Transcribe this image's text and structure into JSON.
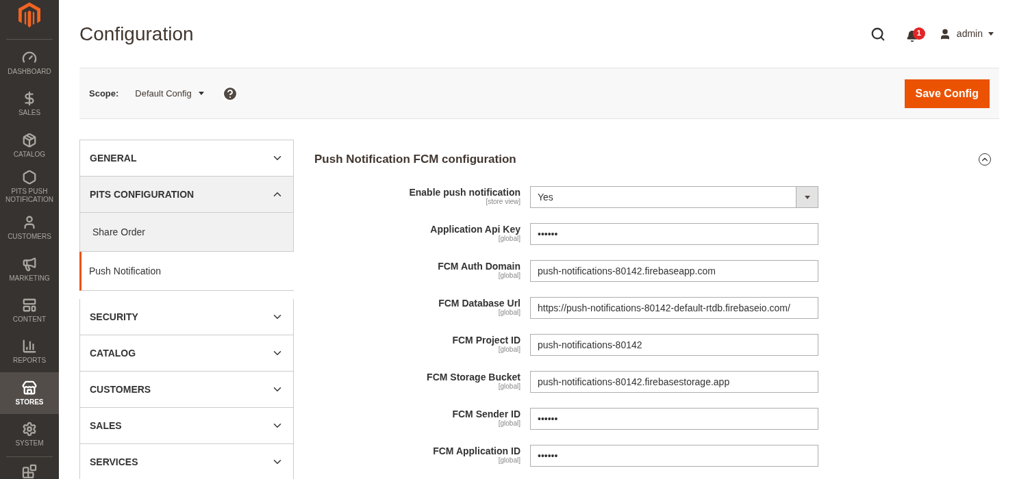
{
  "sidebar": {
    "items": [
      {
        "label": "DASHBOARD",
        "selected": false
      },
      {
        "label": "SALES",
        "selected": false
      },
      {
        "label": "CATALOG",
        "selected": false
      },
      {
        "label": "PITS PUSH NOTIFICATION",
        "selected": false
      },
      {
        "label": "CUSTOMERS",
        "selected": false
      },
      {
        "label": "MARKETING",
        "selected": false
      },
      {
        "label": "CONTENT",
        "selected": false
      },
      {
        "label": "REPORTS",
        "selected": false
      },
      {
        "label": "STORES",
        "selected": true
      },
      {
        "label": "SYSTEM",
        "selected": false
      }
    ]
  },
  "header": {
    "title": "Configuration",
    "notifications": "1",
    "user": "admin"
  },
  "scope": {
    "label": "Scope:",
    "value": "Default Config",
    "button": "Save Config"
  },
  "nav": [
    {
      "label": "GENERAL",
      "expanded": false
    },
    {
      "label": "PITS CONFIGURATION",
      "expanded": true,
      "children": [
        {
          "label": "Share Order",
          "selected": false
        },
        {
          "label": "Push Notification",
          "selected": true
        }
      ]
    },
    {
      "label": "SECURITY",
      "expanded": false
    },
    {
      "label": "CATALOG",
      "expanded": false
    },
    {
      "label": "CUSTOMERS",
      "expanded": false
    },
    {
      "label": "SALES",
      "expanded": false
    },
    {
      "label": "SERVICES",
      "expanded": false
    }
  ],
  "section": {
    "title": "Push Notification FCM configuration",
    "expanded": true,
    "fields": [
      {
        "label": "Enable push notification",
        "scope": "[store view]",
        "kind": "select",
        "value": "Yes"
      },
      {
        "label": "Application Api Key",
        "scope": "[global]",
        "kind": "text",
        "value": "••••••"
      },
      {
        "label": "FCM Auth Domain",
        "scope": "[global]",
        "kind": "text",
        "value": "push-notifications-80142.firebaseapp.com"
      },
      {
        "label": "FCM Database Url",
        "scope": "[global]",
        "kind": "text",
        "value": "https://push-notifications-80142-default-rtdb.firebaseio.com/"
      },
      {
        "label": "FCM Project ID",
        "scope": "[global]",
        "kind": "text",
        "value": "push-notifications-80142"
      },
      {
        "label": "FCM Storage Bucket",
        "scope": "[global]",
        "kind": "text",
        "value": "push-notifications-80142.firebasestorage.app"
      },
      {
        "label": "FCM Sender ID",
        "scope": "[global]",
        "kind": "text",
        "value": "••••••"
      },
      {
        "label": "FCM Application ID",
        "scope": "[global]",
        "kind": "text",
        "value": "••••••"
      }
    ]
  }
}
